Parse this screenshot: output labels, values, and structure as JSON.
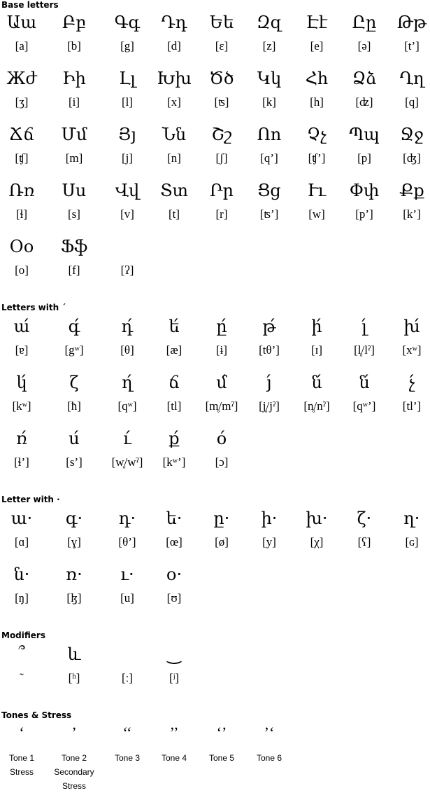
{
  "sections": {
    "base": {
      "title": "Base letters",
      "rows": [
        [
          {
            "g": "Աա",
            "ipa": "[a]"
          },
          {
            "g": "Բբ",
            "ipa": "[b]"
          },
          {
            "g": "Գգ",
            "ipa": "[g]"
          },
          {
            "g": "Դդ",
            "ipa": "[d]"
          },
          {
            "g": "Եե",
            "ipa": "[ɛ]"
          },
          {
            "g": "Զզ",
            "ipa": "[z]"
          },
          {
            "g": "Էէ",
            "ipa": "[e]"
          },
          {
            "g": "Ըը",
            "ipa": "[ə]"
          },
          {
            "g": "Թթ",
            "ipa": "[t’]"
          }
        ],
        [
          {
            "g": "Жժ",
            "ipa": "[ʒ]"
          },
          {
            "g": "Իի",
            "ipa": "[i]"
          },
          {
            "g": "Լլ",
            "ipa": "[l]"
          },
          {
            "g": "Խխ",
            "ipa": "[x]"
          },
          {
            "g": "Ծծ",
            "ipa": "[ʦ]"
          },
          {
            "g": "Կկ",
            "ipa": "[k]"
          },
          {
            "g": "Հհ",
            "ipa": "[h]"
          },
          {
            "g": "Ձձ",
            "ipa": "[ʣ]"
          },
          {
            "g": "Ղղ",
            "ipa": "[q]"
          }
        ],
        [
          {
            "g": "Ճճ",
            "ipa": "[ʧ]"
          },
          {
            "g": "Մմ",
            "ipa": "[m]"
          },
          {
            "g": "Յյ",
            "ipa": "[j]"
          },
          {
            "g": "Նն",
            "ipa": "[n]"
          },
          {
            "g": "Շշ",
            "ipa": "[ʃ]"
          },
          {
            "g": "Ոո",
            "ipa": "[q’]"
          },
          {
            "g": "Չչ",
            "ipa": "[ʧ’]"
          },
          {
            "g": "Պպ",
            "ipa": "[p]"
          },
          {
            "g": "Ջջ",
            "ipa": "[ʤ]"
          }
        ],
        [
          {
            "g": "Ռռ",
            "ipa": "[ɬ]"
          },
          {
            "g": "Սս",
            "ipa": "[s]"
          },
          {
            "g": "Վվ",
            "ipa": "[v]"
          },
          {
            "g": "Տտ",
            "ipa": "[t]"
          },
          {
            "g": "Րր",
            "ipa": "[r]"
          },
          {
            "g": "Ցց",
            "ipa": "[ʦ’]"
          },
          {
            "g": "Ււ",
            "ipa": "[w]"
          },
          {
            "g": "Փփ",
            "ipa": "[p’]"
          },
          {
            "g": "Քք",
            "ipa": "[k’]"
          }
        ],
        [
          {
            "g": "Օօ",
            "ipa": "[o]"
          },
          {
            "g": "Ֆֆ",
            "ipa": "[f]"
          },
          {
            "g": "",
            "ipa": "[ʔ]"
          }
        ]
      ]
    },
    "acute": {
      "title": "Letters with ´",
      "rows": [
        [
          {
            "g": "ա́",
            "ipa": "[ɐ]"
          },
          {
            "g": "գ́",
            "ipa": "[gʷ]"
          },
          {
            "g": "դ́",
            "ipa": "[θ]"
          },
          {
            "g": "ե́",
            "ipa": "[æ]"
          },
          {
            "g": "ը́",
            "ipa": "[ɨ]"
          },
          {
            "g": "թ́",
            "ipa": "[tθ’]"
          },
          {
            "g": "ի́",
            "ipa": "[ɪ]"
          },
          {
            "g": "լ́",
            "ipa": "[l̥/lˀ]"
          },
          {
            "g": "խ́",
            "ipa": "[xʷ]"
          }
        ],
        [
          {
            "g": "կ́",
            "ipa": "[kʷ]"
          },
          {
            "g": "ζ",
            "ipa": "[ħ]"
          },
          {
            "g": "ղ́",
            "ipa": "[qʷ]"
          },
          {
            "g": "ճ",
            "ipa": "[tl]"
          },
          {
            "g": "մ́",
            "ipa": "[m̥/mˀ]"
          },
          {
            "g": "յ́",
            "ipa": "[j̥/jˀ]"
          },
          {
            "g": "ն́",
            "ipa": "[n̥/nˀ]"
          },
          {
            "g": "ն́",
            "ipa": "[qʷ’]"
          },
          {
            "g": "չ́",
            "ipa": "[tl’]"
          }
        ],
        [
          {
            "g": "ռ́",
            "ipa": "[ɬ’]"
          },
          {
            "g": "ս́",
            "ipa": "[s’]"
          },
          {
            "g": "ւ́",
            "ipa": "[w̥/wˀ]"
          },
          {
            "g": "ք́",
            "ipa": "[kʷ’]"
          },
          {
            "g": "ó",
            "ipa": "[ɔ]"
          }
        ]
      ]
    },
    "dot": {
      "title": "Letter with ·",
      "rows": [
        [
          {
            "g": "ա·",
            "ipa": "[ɑ]"
          },
          {
            "g": "գ·",
            "ipa": "[ɣ]"
          },
          {
            "g": "դ·",
            "ipa": "[θ’]"
          },
          {
            "g": "ե·",
            "ipa": "[œ]"
          },
          {
            "g": "ը·",
            "ipa": "[ø]"
          },
          {
            "g": "ի·",
            "ipa": "[y]"
          },
          {
            "g": "խ·",
            "ipa": "[χ]"
          },
          {
            "g": "ζ·",
            "ipa": "[ʕ]"
          },
          {
            "g": "ղ·",
            "ipa": "[ɢ]"
          }
        ],
        [
          {
            "g": "ն·",
            "ipa": "[ŋ]"
          },
          {
            "g": "ռ·",
            "ipa": "[ɮ]"
          },
          {
            "g": "ւ·",
            "ipa": "[u]"
          },
          {
            "g": "օ·",
            "ipa": "[ʊ]"
          }
        ]
      ]
    },
    "modifiers": {
      "title": "Modifiers",
      "items": [
        {
          "g": "՞",
          "ipa": "˜"
        },
        {
          "g": "և",
          "ipa": "[ʰ]"
        },
        {
          "g": "",
          "ipa": "[ː]"
        },
        {
          "g": "‿",
          "ipa": "[ʲ]"
        }
      ]
    },
    "tones": {
      "title": "Tones & Stress",
      "items": [
        {
          "g": "‘",
          "label1": "Tone 1",
          "label2": "Stress",
          "label3": ""
        },
        {
          "g": "’",
          "label1": "Tone 2",
          "label2": "Secondary",
          "label3": "Stress"
        },
        {
          "g": "‘‘",
          "label1": "Tone 3",
          "label2": "",
          "label3": ""
        },
        {
          "g": "’’",
          "label1": "Tone 4",
          "label2": "",
          "label3": ""
        },
        {
          "g": "‘’",
          "label1": "Tone 5",
          "label2": "",
          "label3": ""
        },
        {
          "g": "’‘",
          "label1": "Tone 6",
          "label2": "",
          "label3": ""
        }
      ]
    }
  }
}
